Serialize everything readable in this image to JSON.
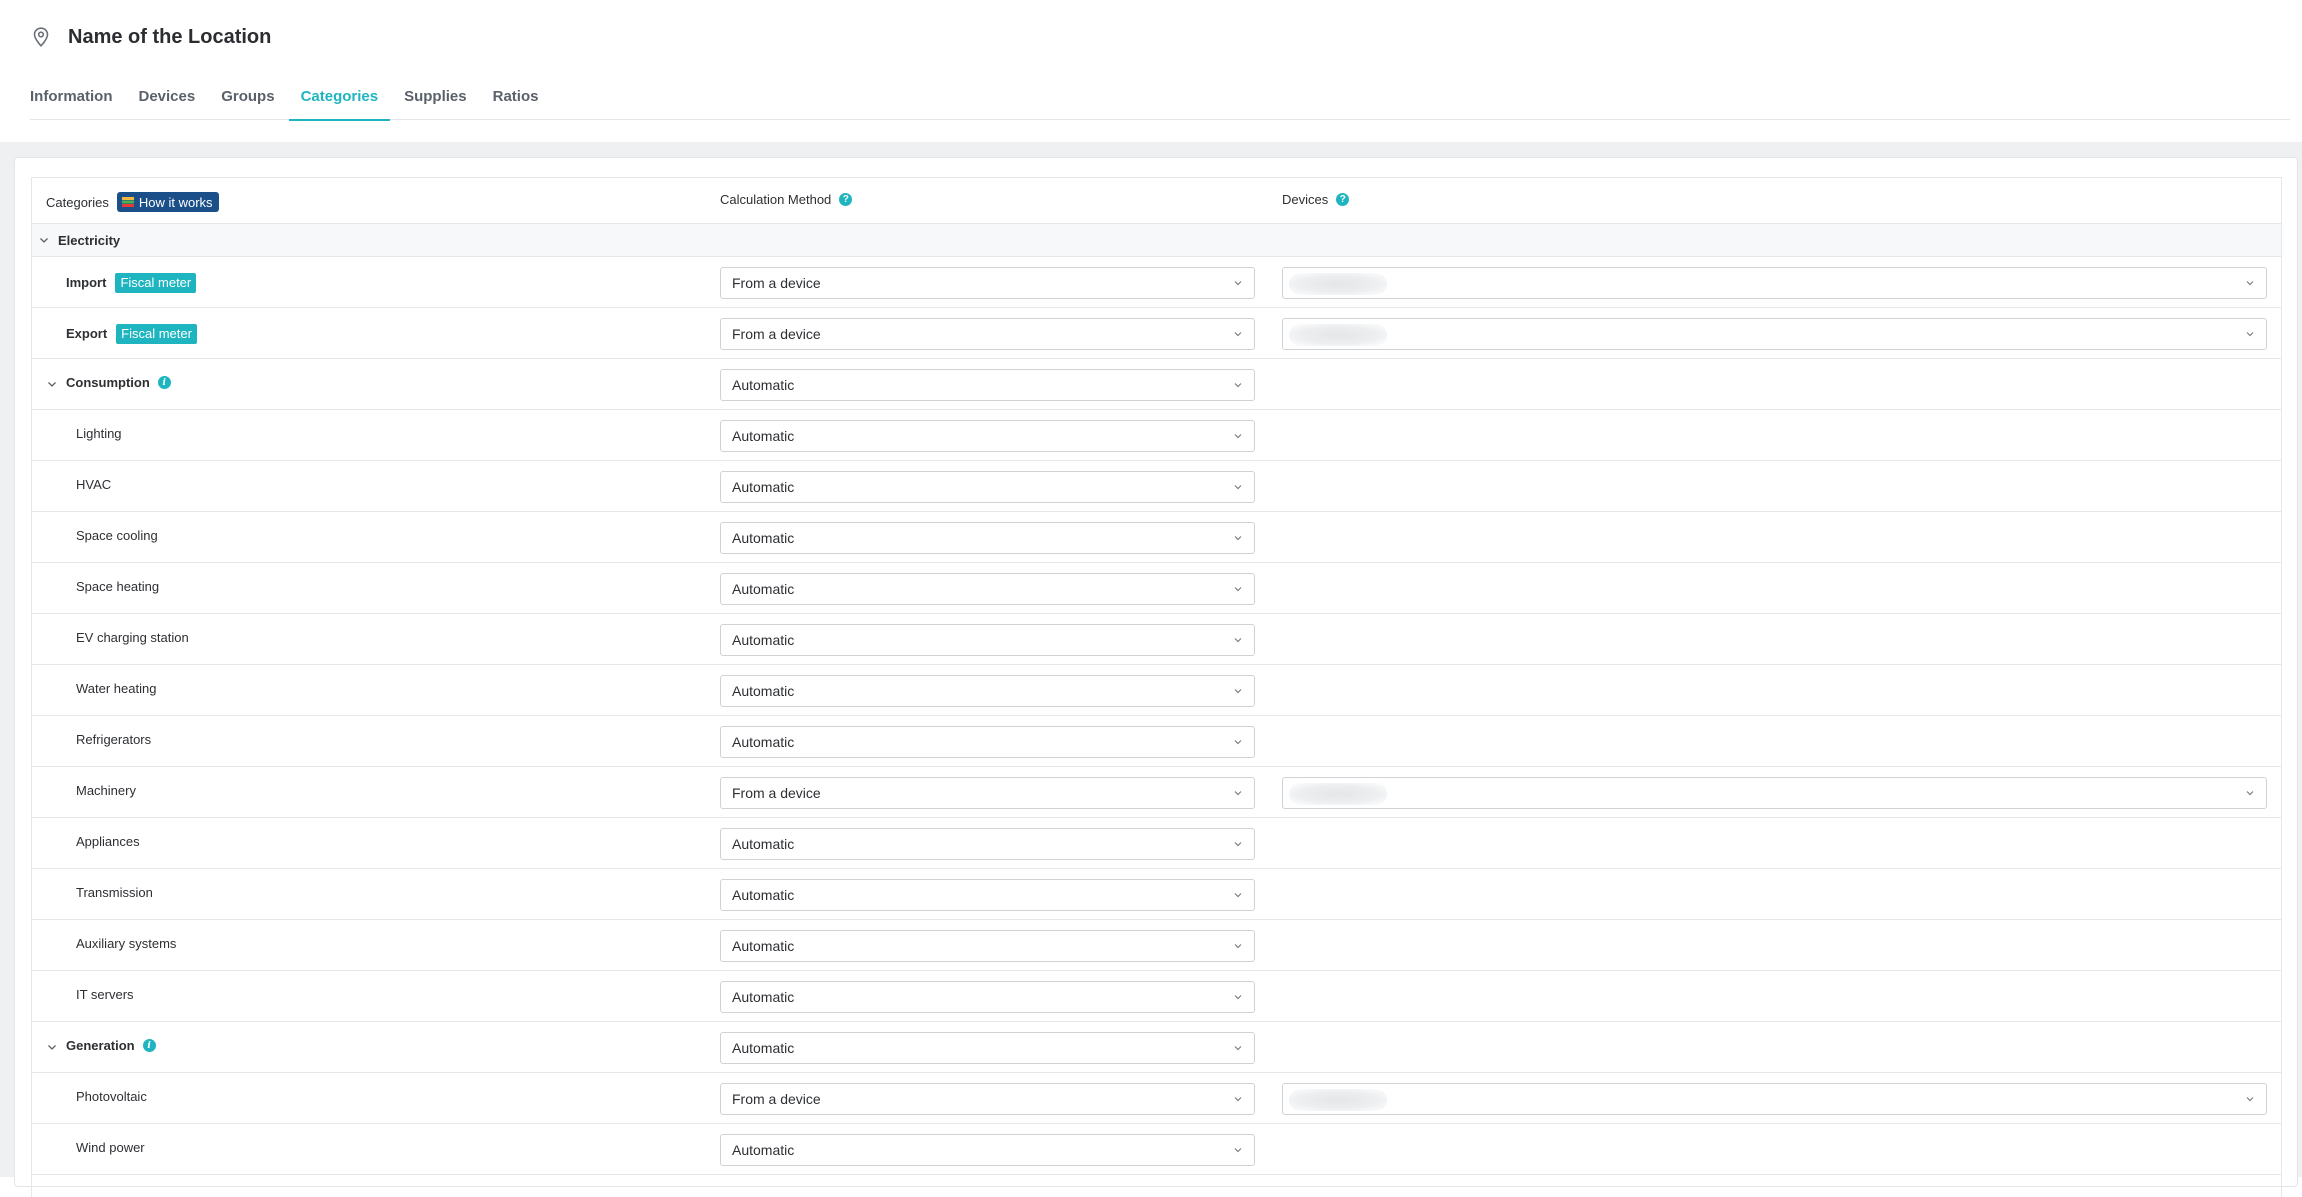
{
  "header": {
    "title": "Name of the Location",
    "tabs": [
      {
        "label": "Information",
        "active": false
      },
      {
        "label": "Devices",
        "active": false
      },
      {
        "label": "Groups",
        "active": false
      },
      {
        "label": "Categories",
        "active": true
      },
      {
        "label": "Supplies",
        "active": false
      },
      {
        "label": "Ratios",
        "active": false
      }
    ]
  },
  "table": {
    "col_categories": "Categories",
    "how_it_works": "How it works",
    "col_calc": "Calculation Method",
    "col_devices": "Devices",
    "section_electricity": "Electricity",
    "fiscal_meter": "Fiscal meter",
    "rows": [
      {
        "label": "Import",
        "method": "From a device"
      },
      {
        "label": "Export",
        "method": "From a device"
      },
      {
        "label": "Consumption",
        "method": "Automatic"
      },
      {
        "label": "Lighting",
        "method": "Automatic"
      },
      {
        "label": "HVAC",
        "method": "Automatic"
      },
      {
        "label": "Space cooling",
        "method": "Automatic"
      },
      {
        "label": "Space heating",
        "method": "Automatic"
      },
      {
        "label": "EV charging station",
        "method": "Automatic"
      },
      {
        "label": "Water heating",
        "method": "Automatic"
      },
      {
        "label": "Refrigerators",
        "method": "Automatic"
      },
      {
        "label": "Machinery",
        "method": "From a device"
      },
      {
        "label": "Appliances",
        "method": "Automatic"
      },
      {
        "label": "Transmission",
        "method": "Automatic"
      },
      {
        "label": "Auxiliary systems",
        "method": "Automatic"
      },
      {
        "label": "IT servers",
        "method": "Automatic"
      },
      {
        "label": "Generation",
        "method": "Automatic"
      },
      {
        "label": "Photovoltaic",
        "method": "From a device"
      },
      {
        "label": "Wind power",
        "method": "Automatic"
      }
    ]
  },
  "colors": {
    "accent": "#1fb5c0",
    "how_badge": "#1b4f8a"
  },
  "icons": [
    "map-pin-icon",
    "book-icon",
    "question-icon",
    "info-icon",
    "chevron-down-icon"
  ]
}
